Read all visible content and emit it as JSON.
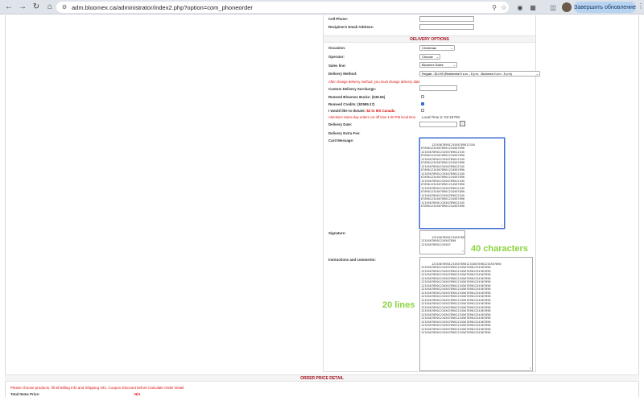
{
  "browser": {
    "url": "adm.bloomex.ca/administrator/index2.php?option=com_phoneorder",
    "update_button": "Завершить обновление"
  },
  "top_fields": {
    "cell_phone_label": "Cell Phone:",
    "recipient_email_label": "Recipient's Email Address:"
  },
  "delivery": {
    "section_title": "DELIVERY OPTIONS",
    "occasion_label": "Occasion:",
    "occasion_value": "Christmas",
    "operator_label": "Operator:",
    "operator_value": "Choose",
    "sales_line_label": "Sales line:",
    "sales_line_value": "Bloomex Sales",
    "delivery_method_label": "Delivery Method:",
    "delivery_method_value": "Regular - $14.99 (Residential 9 a.m. - 8 p.m. ; Business 9 a.m - 5 p.m)",
    "method_note": "After change delivery method, you must change delivery date",
    "surcharge_label": "Custom Delivery Surcharge:",
    "bucks_label": "Remeed Bloomex Bucks: ($38.66)",
    "credits_label": "Remeed Credits: ($2589.17)",
    "donate_prefix": "I would like to donate: ",
    "donate_amount": "$2 to MS Canada",
    "cutoff_note": "Attention! Same day orders cut off time 1:00 PM local time.",
    "local_time": "Local Time is: 02:18 PM",
    "delivery_date_label": "Delivery Date:",
    "extra_fee_label": "Delivery Extra Fee:",
    "card_message_label": "Card Message:",
    "card_message_value": "1234567890123456789012345\n6789012345678901234567890\n1234567890123456789012345\n6789012345678901234567890\n1234567890123456789012345\n6789012345678901234567890\n1234567890123456789012345\n6789012345678901234567890\n1234567890123456789012345\n6789012345678901234567890\n1234567890123456789012345\n6789012345678901234567890\n1234567890123456789012345\n6789012345678901234567890\n1234567890123456789012345\n6789012345678901234567890\n1234567890123456789012345\n6789012345678901234567890",
    "signature_label": "Signature:",
    "signature_value": "12345678901234567890\n12345678901234567890\n12345678901234567",
    "instructions_label": "Instructions and comments:",
    "instructions_value": "1234567890123456789012345678901234567890\n1234567890123456789012345678901234567890\n1234567890123456789012345678901234567890\n1234567890123456789012345678901234567890\n1234567890123456789012345678901234567890\n1234567890123456789012345678901234567890\n1234567890123456789012345678901234567890\n1234567890123456789012345678901234567890\n1234567890123456789012345678901234567890\n1234567890123456789012345678901234567890\n1234567890123456789012345678901234567890\n1234567890123456789012345678901234567890\n1234567890123456789012345678901234567890\n1234567890123456789012345678901234567890\n1234567890123456789012345678901234567890\n1234567890123456789012345678901234567890\n1234567890123456789012345678901234567890\n1234567890123456789012345678901234567890\n1234567890123456789012345678901234567890\n1234567890123456789012345678901234567890"
  },
  "annotations": {
    "chars": "40 characters",
    "lines": "20 lines"
  },
  "order": {
    "section_title": "ORDER PRICE DETAIL",
    "note": "Please choose products, fill all Billing Info and Shipping Info, Coupon Discount before Calculate Order Detail",
    "total_label": "Total Items Price:",
    "total_value": "N/A"
  },
  "colors": {
    "section_title": "#a3131e",
    "annotation": "#8bd43f",
    "warning": "#dd1111"
  }
}
